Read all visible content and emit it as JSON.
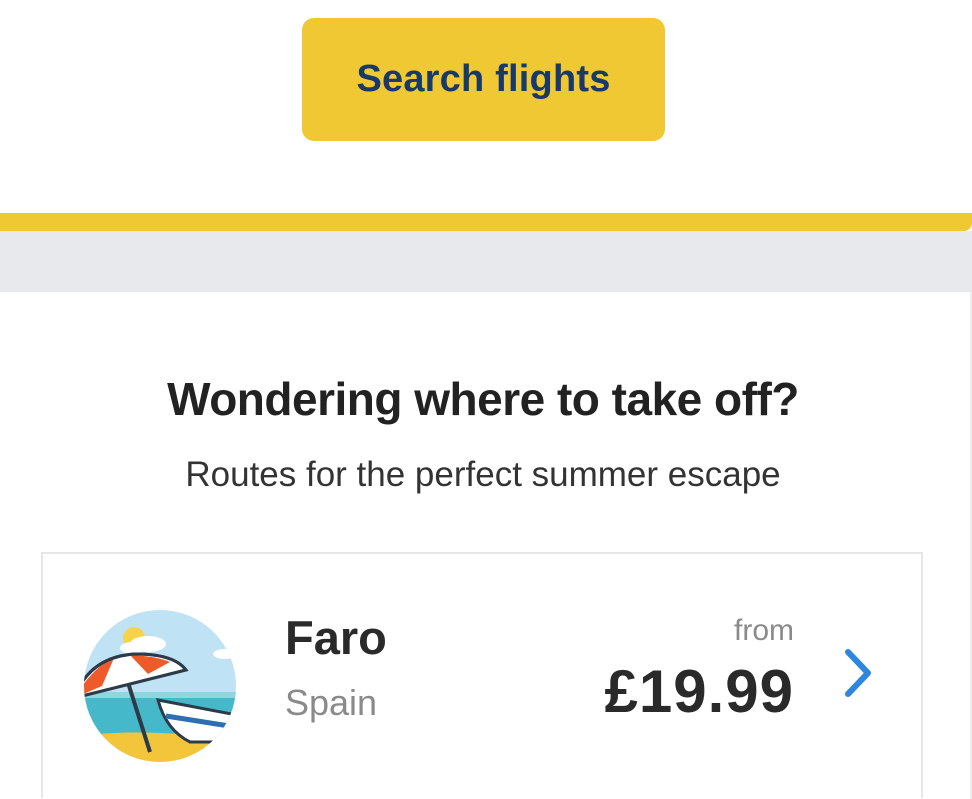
{
  "search": {
    "button_label": "Search flights"
  },
  "section": {
    "title": "Wondering where to take off?",
    "subtitle": "Routes for the perfect summer escape"
  },
  "route": {
    "city": "Faro",
    "country": "Spain",
    "from_label": "from",
    "price": "£19.99",
    "image_icon": "beach-umbrella-icon",
    "arrow_icon": "chevron-right-icon"
  },
  "colors": {
    "accent_yellow": "#efc833",
    "button_text": "#173a6b",
    "chevron_blue": "#2e86de",
    "band_grey": "#e7e9ec"
  }
}
